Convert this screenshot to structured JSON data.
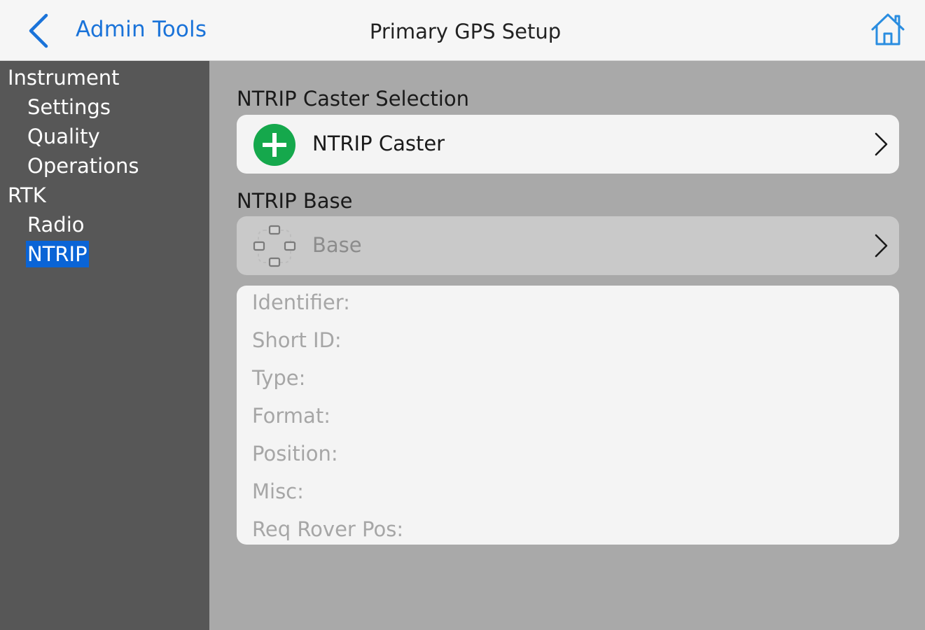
{
  "header": {
    "back_label": "Admin Tools",
    "title": "Primary GPS Setup",
    "back_icon": "chevron-left-icon",
    "home_icon": "home-icon"
  },
  "colors": {
    "accent": "#1a73d9",
    "sidebar_bg": "#575757",
    "selected_bg": "#0a64d6",
    "main_bg": "#a9a9a9",
    "add_icon": "#15a84c"
  },
  "sidebar": {
    "groups": [
      {
        "label": "Instrument",
        "items": [
          {
            "label": "Settings"
          },
          {
            "label": "Quality"
          },
          {
            "label": "Operations"
          }
        ]
      },
      {
        "label": "RTK",
        "items": [
          {
            "label": "Radio"
          },
          {
            "label": "NTRIP"
          }
        ]
      }
    ],
    "selected": "NTRIP"
  },
  "main": {
    "caster_section": {
      "label": "NTRIP Caster Selection",
      "row_label": "NTRIP Caster",
      "icon": "add-circle-icon"
    },
    "base_section": {
      "label": "NTRIP Base",
      "row_label": "Base",
      "icon": "base-network-icon"
    },
    "details": [
      {
        "label": "Identifier:"
      },
      {
        "label": "Short ID:"
      },
      {
        "label": "Type:"
      },
      {
        "label": "Format:"
      },
      {
        "label": "Position:"
      },
      {
        "label": "Misc:"
      },
      {
        "label": "Req Rover Pos:"
      }
    ]
  }
}
